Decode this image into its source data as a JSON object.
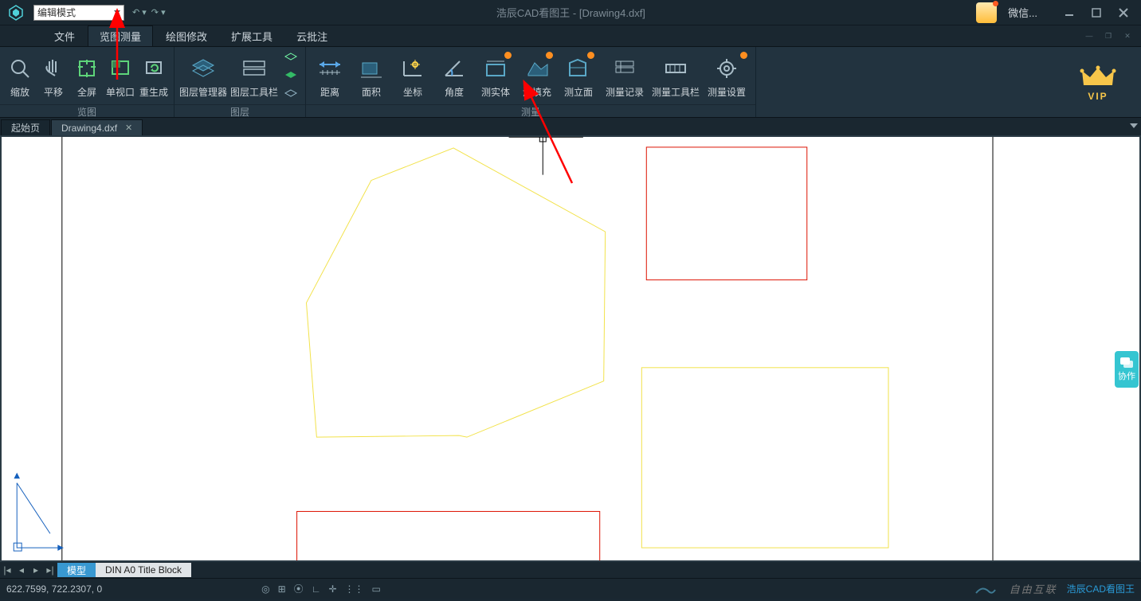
{
  "titlebar": {
    "mode_label": "编辑模式",
    "app_title": "浩辰CAD看图王 - [Drawing4.dxf]",
    "wechat_label": "微信..."
  },
  "menubar": {
    "items": [
      "文件",
      "览图测量",
      "绘图修改",
      "扩展工具",
      "云批注"
    ],
    "active_index": 1
  },
  "ribbon": {
    "groups": [
      {
        "caption": "览图",
        "buttons": [
          "缩放",
          "平移",
          "全屏",
          "单视口",
          "重生成"
        ]
      },
      {
        "caption": "图层",
        "buttons": [
          "图层管理器",
          "图层工具栏"
        ]
      },
      {
        "caption": "测量",
        "buttons": [
          "距离",
          "面积",
          "坐标",
          "角度",
          "测实体",
          "测填充",
          "测立面",
          "测量记录",
          "测量工具栏",
          "测量设置"
        ]
      }
    ],
    "vip_label": "VIP"
  },
  "tabs": {
    "items": [
      {
        "label": "起始页",
        "closable": false
      },
      {
        "label": "Drawing4.dxf",
        "closable": true
      }
    ],
    "active_index": 1
  },
  "collab": {
    "label": "协作"
  },
  "model_tabs": {
    "items": [
      "模型",
      "DIN A0 Title Block"
    ],
    "active_index": 0
  },
  "statusbar": {
    "coords": "622.7599, 722.2307, 0",
    "brand": "浩辰CAD看图王",
    "watermark": "自由互联"
  }
}
